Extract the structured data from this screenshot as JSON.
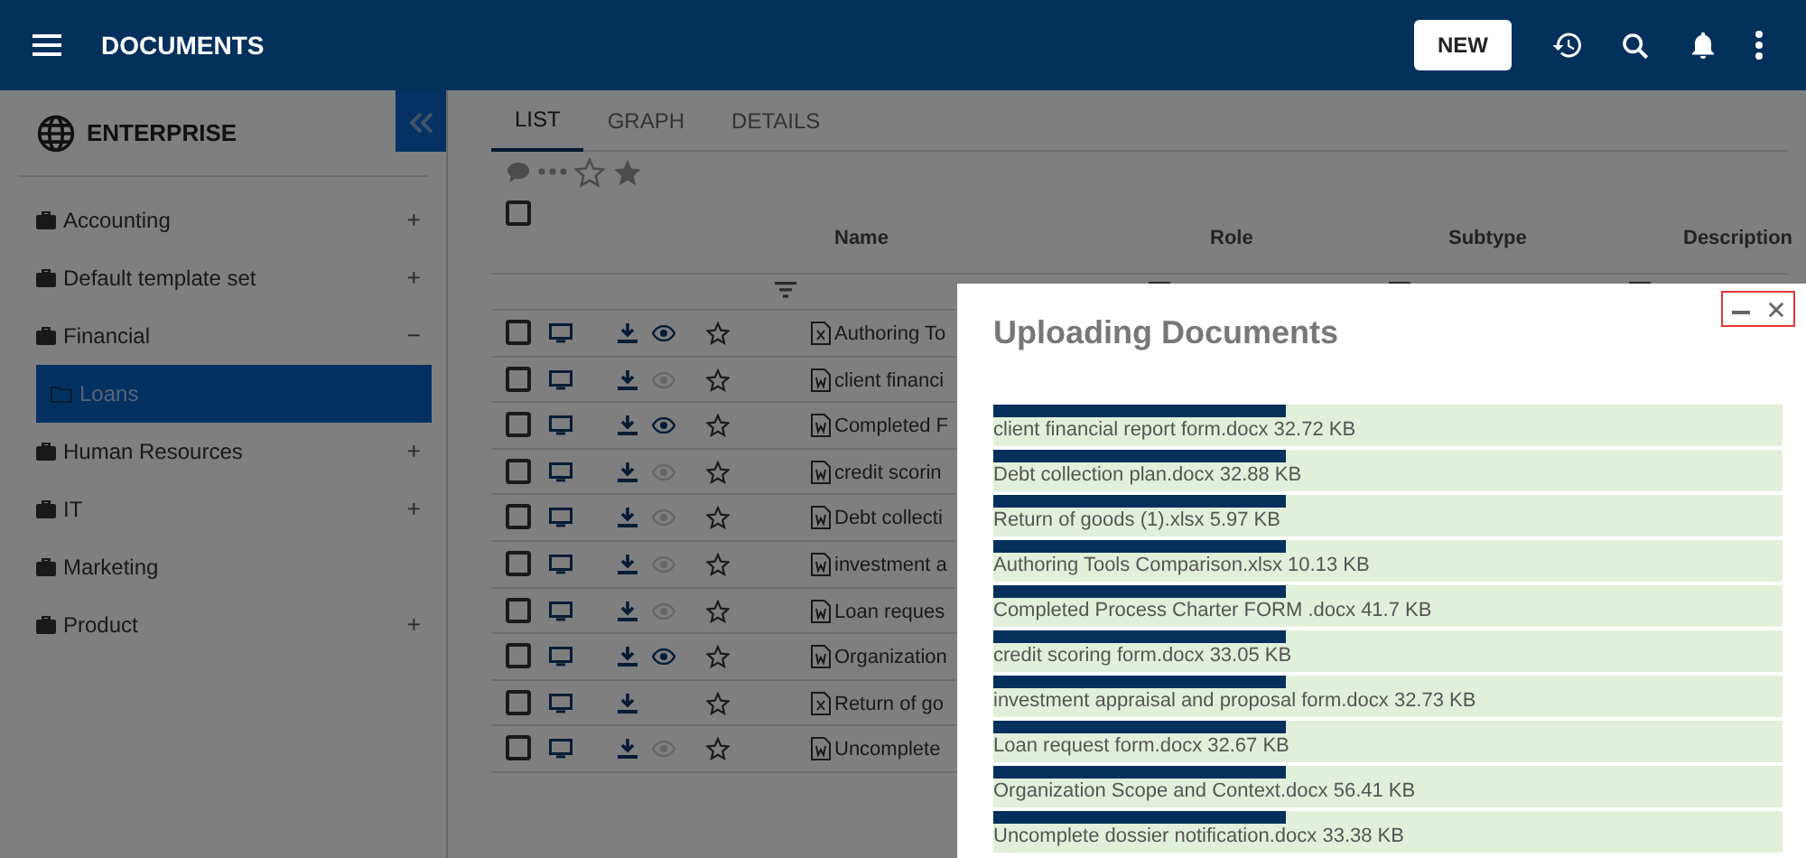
{
  "header": {
    "title": "DOCUMENTS",
    "new_button": "NEW"
  },
  "sidebar": {
    "title": "ENTERPRISE",
    "items": [
      {
        "label": "Accounting",
        "toggle": "+"
      },
      {
        "label": "Default template set",
        "toggle": "+"
      },
      {
        "label": "Financial",
        "toggle": "−",
        "children": [
          {
            "label": "Loans",
            "selected": true
          }
        ]
      },
      {
        "label": "Human Resources",
        "toggle": "+"
      },
      {
        "label": "IT",
        "toggle": "+"
      },
      {
        "label": "Marketing"
      },
      {
        "label": "Product",
        "toggle": "+"
      }
    ]
  },
  "tabs": [
    {
      "label": "LIST",
      "selected": true
    },
    {
      "label": "GRAPH",
      "selected": false
    },
    {
      "label": "DETAILS",
      "selected": false
    }
  ],
  "table": {
    "all_checked": false,
    "columns": [
      "Name",
      "Role",
      "Subtype",
      "Description"
    ],
    "rows": [
      {
        "checked": false,
        "preview_enabled": true,
        "spreadsheet": true,
        "name": "Authoring To"
      },
      {
        "checked": false,
        "preview_enabled": false,
        "spreadsheet": false,
        "name": "client financi"
      },
      {
        "checked": false,
        "preview_enabled": true,
        "spreadsheet": false,
        "name": "Completed F"
      },
      {
        "checked": false,
        "preview_enabled": false,
        "spreadsheet": false,
        "name": "credit scorin"
      },
      {
        "checked": false,
        "preview_enabled": false,
        "spreadsheet": false,
        "name": "Debt collecti"
      },
      {
        "checked": false,
        "preview_enabled": false,
        "spreadsheet": false,
        "name": "investment a"
      },
      {
        "checked": false,
        "preview_enabled": false,
        "spreadsheet": false,
        "name": "Loan reques"
      },
      {
        "checked": false,
        "preview_enabled": true,
        "spreadsheet": false,
        "name": "Organization"
      },
      {
        "checked": false,
        "spreadsheet": true,
        "name": "Return of go"
      },
      {
        "checked": false,
        "preview_enabled": false,
        "spreadsheet": false,
        "name": "Uncomplete"
      }
    ]
  },
  "dialog": {
    "title": "Uploading Documents",
    "controls_highlighted": true,
    "uploads": [
      {
        "label": "client financial report form.docx 32.72 KB",
        "level": 0.37
      },
      {
        "label": "Debt collection plan.docx 32.88 KB",
        "level": 0.37
      },
      {
        "label": "Return of goods (1).xlsx 5.97 KB",
        "level": 0.37
      },
      {
        "label": "Authoring Tools Comparison.xlsx 10.13 KB",
        "level": 0.37
      },
      {
        "label": "Completed Process Charter FORM .docx 41.7 KB",
        "level": 0.37
      },
      {
        "label": "credit scoring form.docx 33.05 KB",
        "level": 0.37
      },
      {
        "label": "investment appraisal and proposal form.docx 32.73 KB",
        "level": 0.37
      },
      {
        "label": "Loan request form.docx 32.67 KB",
        "level": 0.37
      },
      {
        "label": "Organization Scope and Context.docx 56.41 KB",
        "level": 0.37
      },
      {
        "label": "Uncomplete dossier notification.docx 33.38 KB",
        "level": 0.37
      }
    ]
  }
}
